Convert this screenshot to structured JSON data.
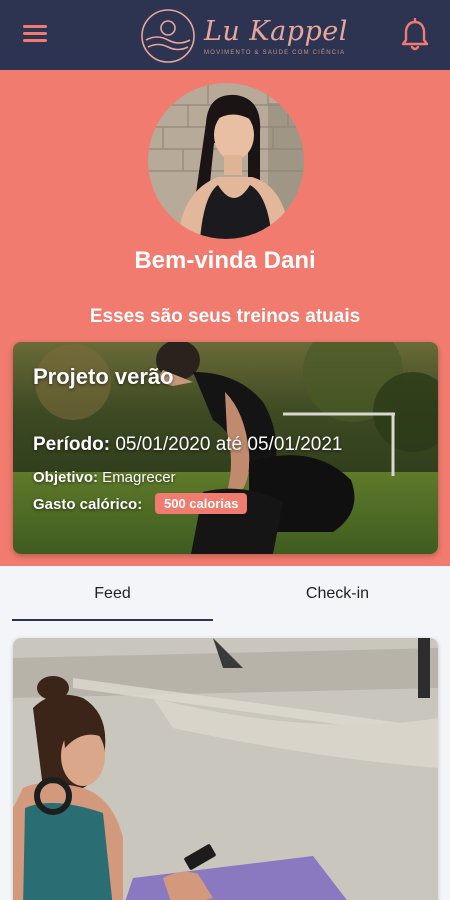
{
  "header": {
    "brand_name": "Lu Kappel",
    "brand_tagline": "movimento & saúde com ciência",
    "menu_icon": "hamburger-menu-icon",
    "notification_icon": "bell-icon",
    "background_color": "#2c3452",
    "accent_color": "#f07b6e"
  },
  "hero": {
    "greeting": "Bem-vinda Dani",
    "subtitle": "Esses são seus treinos atuais",
    "background_color": "#f07b6e"
  },
  "workout": {
    "title": "Projeto verão",
    "period_label": "Período:",
    "period_value": " 05/01/2020 até 05/01/2021",
    "objective_label": "Objetivo:",
    "objective_value": " Emagrecer",
    "calories_label": "Gasto calórico:",
    "calories_badge": "500 calorias"
  },
  "tabs": [
    {
      "label": "Feed",
      "active": true
    },
    {
      "label": "Check-in",
      "active": false
    }
  ]
}
